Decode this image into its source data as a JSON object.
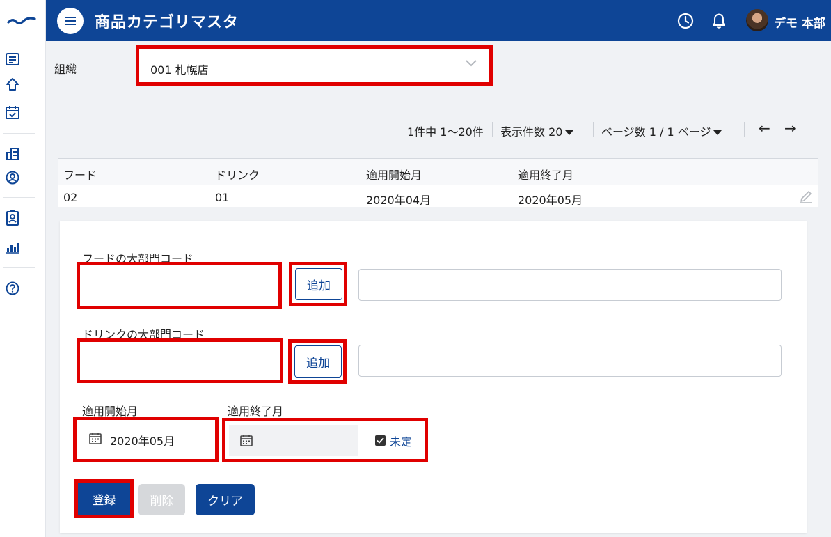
{
  "header": {
    "title": "商品カテゴリマスタ",
    "user_name": "デモ 本部"
  },
  "organization": {
    "label": "組織",
    "selected": "001 札幌店"
  },
  "pagination": {
    "range": "1件中 1〜20件",
    "per_page": "表示件数 20",
    "pages": "ページ数 1 / 1 ページ",
    "prev": "←",
    "next": "→"
  },
  "table": {
    "columns": [
      "フード",
      "ドリンク",
      "適用開始月",
      "適用終了月"
    ],
    "rows": [
      [
        "02",
        "01",
        "2020年04月",
        "2020年05月"
      ]
    ]
  },
  "form": {
    "food_label": "フードの大部門コード",
    "food_value": "",
    "food_add": "追加",
    "drink_label": "ドリンクの大部門コード",
    "drink_value": "",
    "drink_add": "追加",
    "start_label": "適用開始月",
    "start_value": "2020年05月",
    "end_label": "適用終了月",
    "end_value": "",
    "undetermined_label": "未定",
    "undetermined_checked": true
  },
  "buttons": {
    "register": "登録",
    "delete": "削除",
    "clear": "クリア"
  },
  "colors": {
    "brand": "#0e4596",
    "highlight": "#e00000"
  }
}
